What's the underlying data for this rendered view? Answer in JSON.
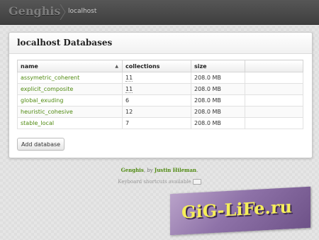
{
  "app": {
    "logo": "Genghis"
  },
  "breadcrumb": {
    "server": "localhost"
  },
  "panel": {
    "title": "localhost Databases"
  },
  "table": {
    "columns": [
      "name",
      "collections",
      "size",
      ""
    ],
    "rows": [
      {
        "name": "assymetric_coherent",
        "collections": "11",
        "size": "208.0 MB"
      },
      {
        "name": "explicit_composite",
        "collections": "11",
        "size": "208.0 MB"
      },
      {
        "name": "global_exuding",
        "collections": "6",
        "size": "208.0 MB"
      },
      {
        "name": "heuristic_cohesive",
        "collections": "12",
        "size": "208.0 MB"
      },
      {
        "name": "stable_local",
        "collections": "7",
        "size": "208.0 MB"
      }
    ]
  },
  "actions": {
    "add_database": "Add database"
  },
  "footer": {
    "app_link": "Genghis",
    "by_text": ", by ",
    "author_link": "Justin Hileman",
    "period": ".",
    "shortcuts": "Keyboard shortcuts available"
  },
  "watermark": {
    "text": "GiG-LiFe.ru"
  },
  "colors": {
    "link": "#4f8a10",
    "topbar": "#4a4a4a",
    "watermark_text": "#f5ee5a"
  }
}
